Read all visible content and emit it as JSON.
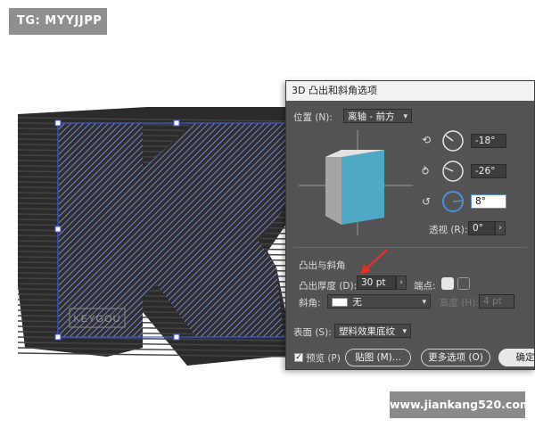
{
  "watermarks": {
    "top": "TG: MYYJJPP",
    "bottom": "www.jiankang520.com"
  },
  "artwork": {
    "logo_text": "KEYGOU",
    "colors": {
      "extrusion": "#2b2b2b",
      "selection": "#3d5bd6",
      "stripes": "#7c8fd6"
    }
  },
  "dialog": {
    "title": "3D 凸出和斜角选项",
    "position_label": "位置 (N):",
    "position_value": "离轴 - 前方",
    "rotation": {
      "x_value": "-18°",
      "y_value": "-26°",
      "z_value": "8°"
    },
    "perspective_label": "透视 (R):",
    "perspective_value": "0°",
    "extrude_section_label": "凸出与斜角",
    "extrude_depth_label": "凸出厚度 (D):",
    "extrude_depth_value": "30 pt",
    "cap_label": "端点:",
    "bevel_label": "斜角:",
    "bevel_value": "无",
    "height_label": "高度 (H):",
    "height_value": "4 pt",
    "surface_label": "表面 (S):",
    "surface_value": "塑料效果底纹",
    "preview_label": "预览 (P)",
    "preview_checked": true,
    "buttons": {
      "map": "贴图 (M)...",
      "more": "更多选项 (O)",
      "ok": "确定"
    }
  },
  "annotation": {
    "arrow_color": "#e0302a"
  }
}
